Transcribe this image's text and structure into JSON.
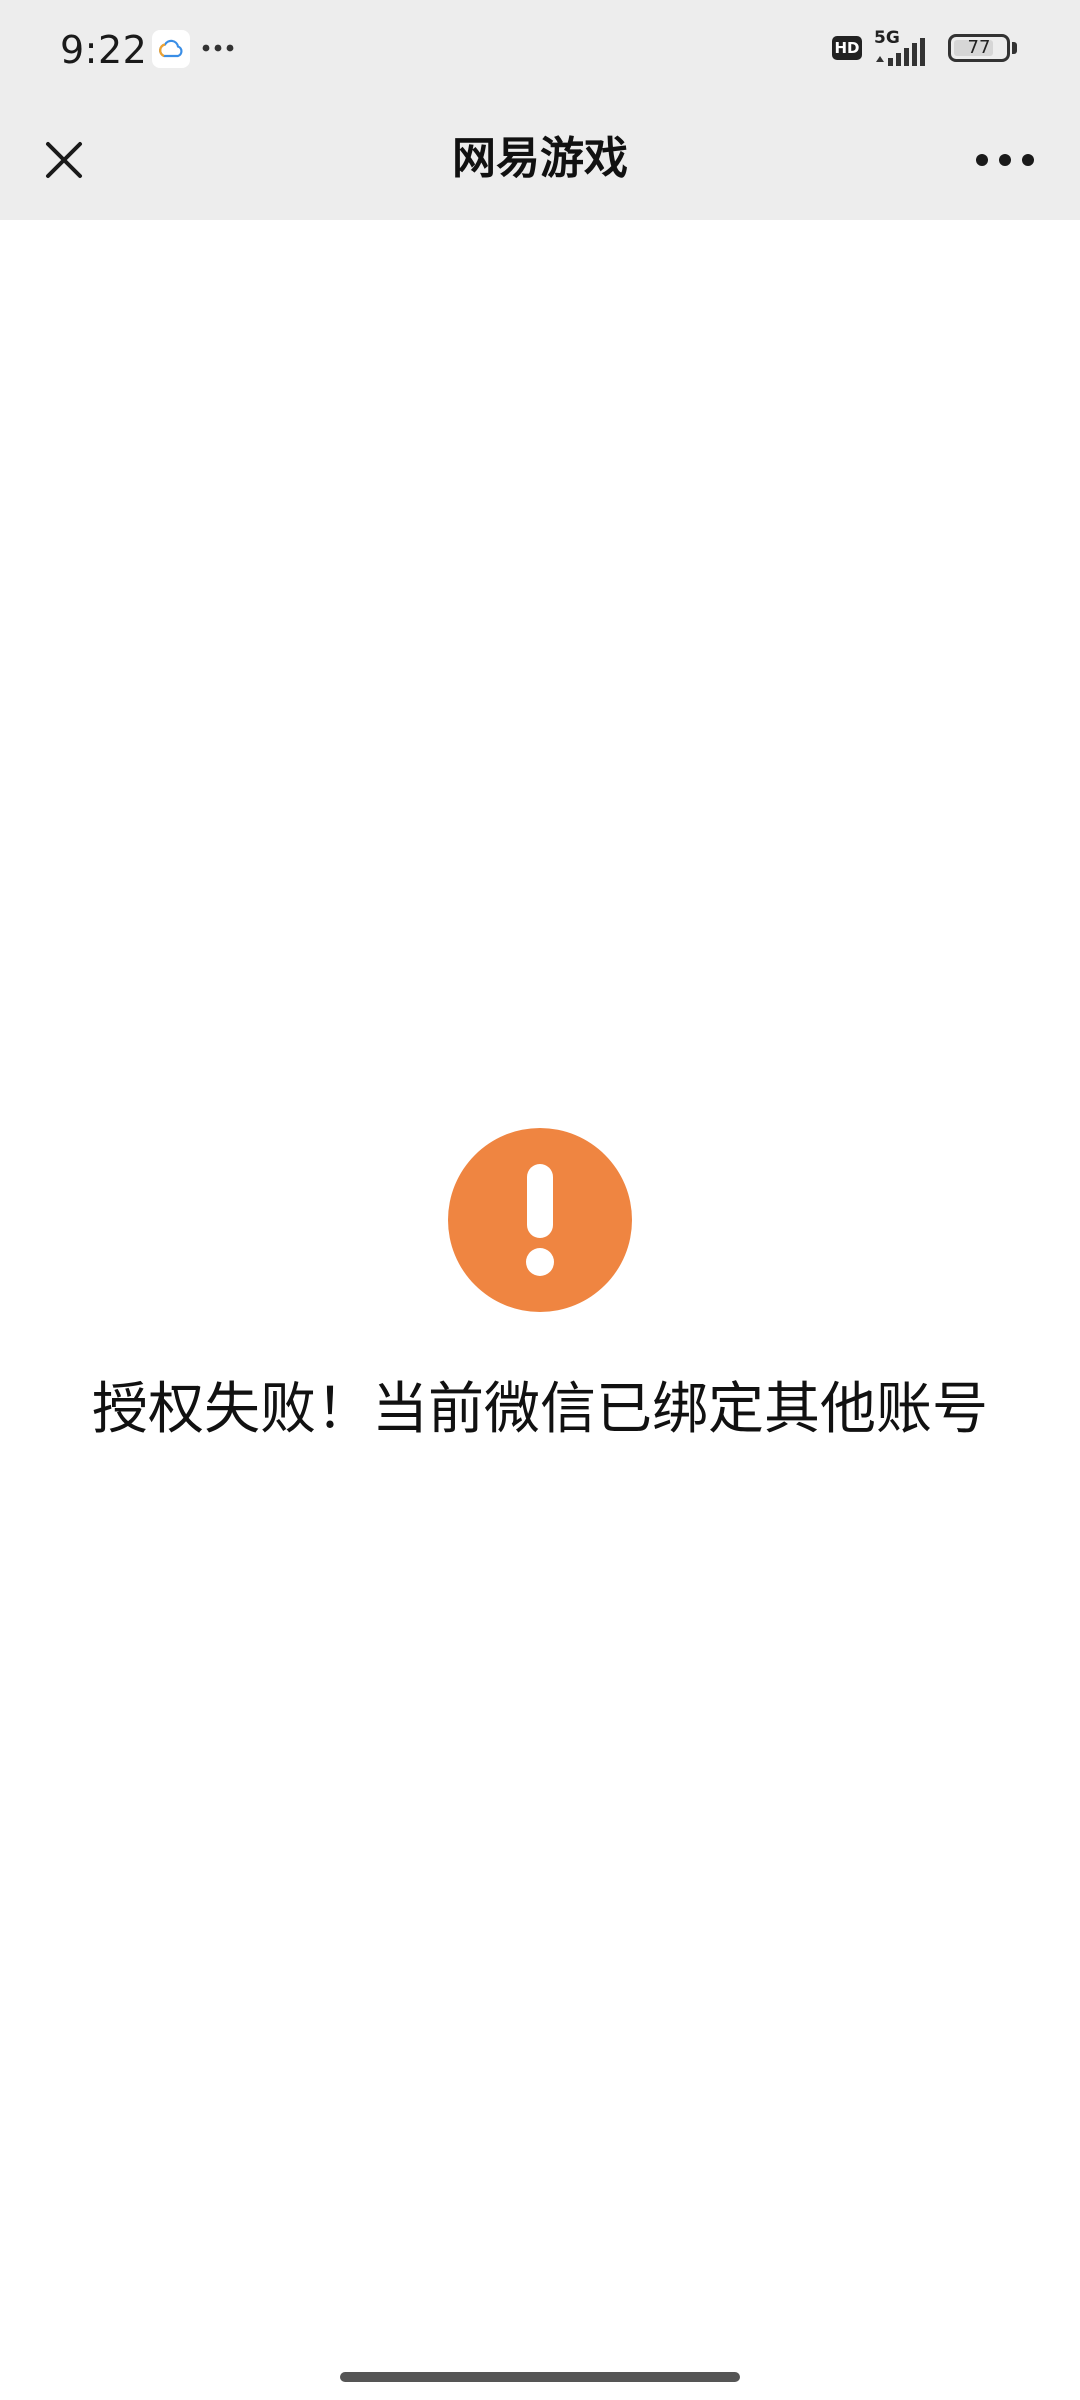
{
  "status_bar": {
    "time": "9:22",
    "hd_badge": "HD",
    "network": "5G",
    "battery": "77",
    "battery_level": 0.77,
    "icons": [
      "weather-cloud-icon",
      "more-dots-icon",
      "hd-icon",
      "signal-icon",
      "battery-icon"
    ]
  },
  "nav": {
    "title": "网易游戏",
    "close_icon": "close-icon",
    "more_icon": "more-horizontal-icon"
  },
  "content": {
    "icon": "exclamation-circle-icon",
    "message": "授权失败！当前微信已绑定其他账号"
  },
  "colors": {
    "status_bar_bg": "#ededed",
    "nav_bg": "#ededed",
    "warning": "#ef8541",
    "text": "#111111",
    "page_bg": "#ffffff"
  }
}
